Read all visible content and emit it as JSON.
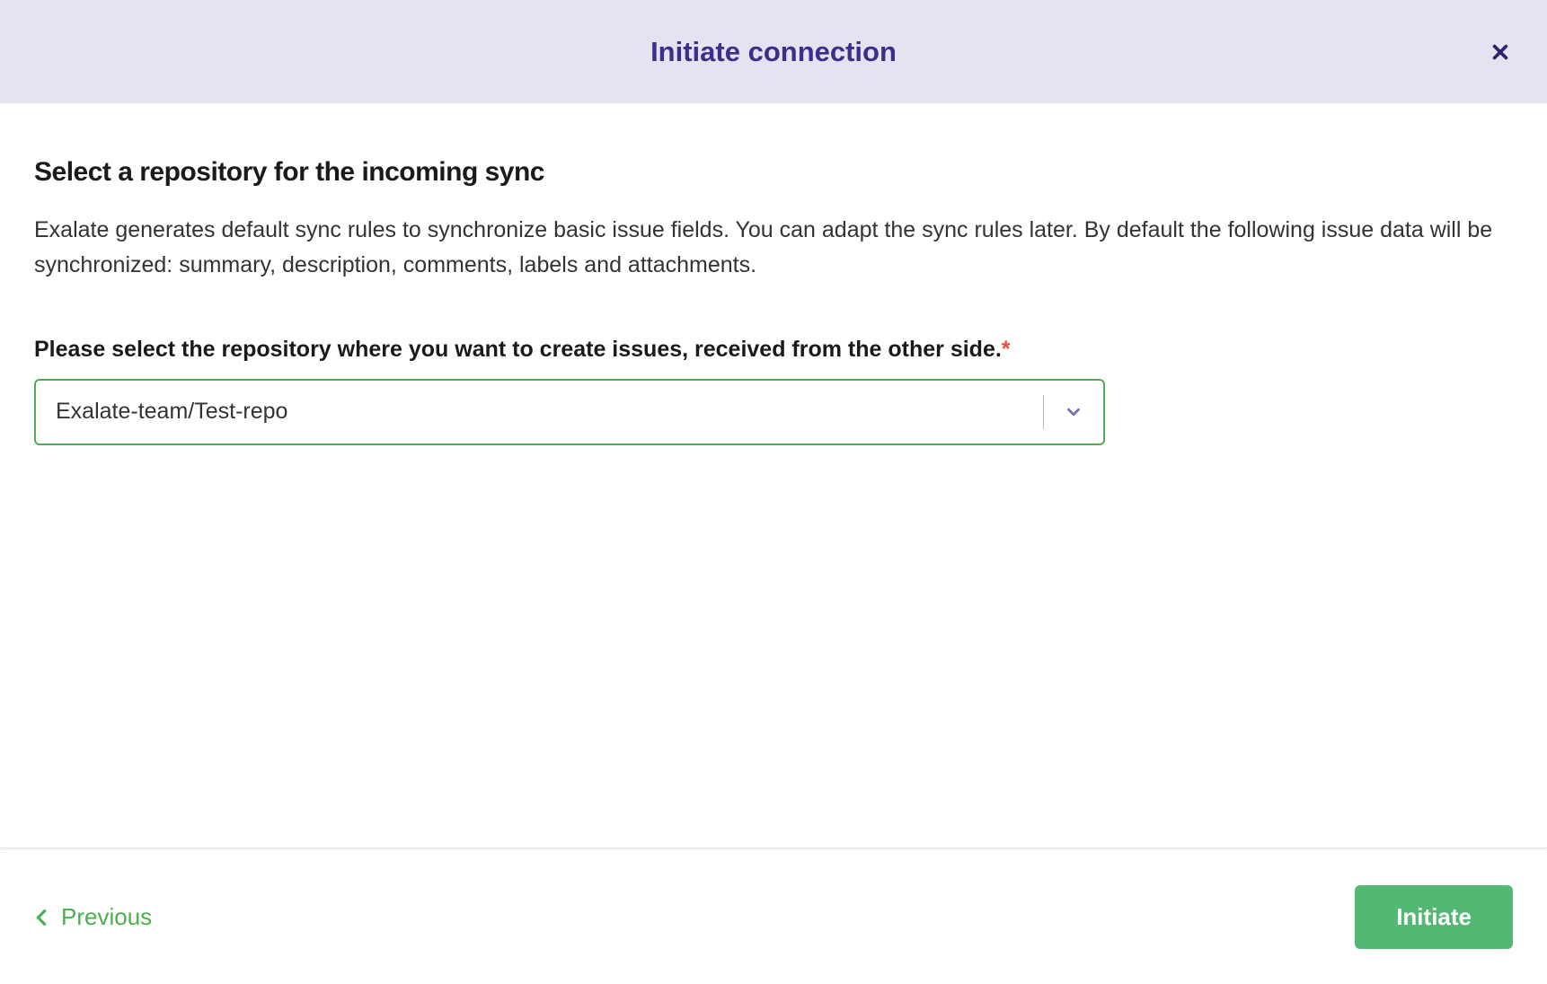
{
  "header": {
    "title": "Initiate connection"
  },
  "body": {
    "heading": "Select a repository for the incoming sync",
    "description": "Exalate generates default sync rules to synchronize basic issue fields. You can adapt the sync rules later. By default the following issue data will be synchronized: summary, description, comments, labels and attachments.",
    "field_label": "Please select the repository where you want to create issues, received from the other side.",
    "required_marker": "*",
    "select": {
      "value": "Exalate-team/Test-repo"
    }
  },
  "footer": {
    "previous_label": "Previous",
    "initiate_label": "Initiate"
  }
}
